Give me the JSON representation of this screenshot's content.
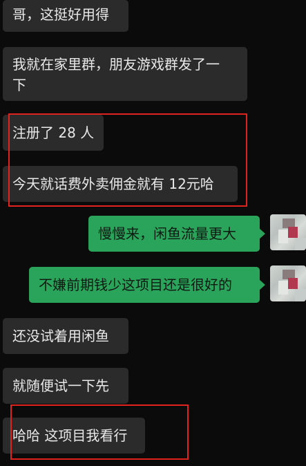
{
  "messages": [
    {
      "side": "left",
      "text": "哥，这挺好用得"
    },
    {
      "side": "left",
      "text_line1": "我就在家里群，朋友游戏群发了一",
      "text_line2": "下"
    },
    {
      "side": "left",
      "text": "注册了 28 人"
    },
    {
      "side": "left",
      "text": "今天就话费外卖佣金就有 12元哈"
    },
    {
      "side": "right",
      "text": "慢慢来，闲鱼流量更大"
    },
    {
      "side": "right",
      "text": "不嫌前期钱少这项目还是很好的"
    },
    {
      "side": "left",
      "text": "还没试着用闲鱼"
    },
    {
      "side": "left",
      "text": "就随便试一下先"
    },
    {
      "side": "left",
      "text": "哈哈 这项目我看行"
    }
  ],
  "colors": {
    "background": "#0b0b0b",
    "left_bubble": "#2b2b2b",
    "right_bubble": "#2aa45a",
    "highlight_box": "#e0231f"
  },
  "avatars": {
    "self": "blurred-avatar-icon"
  }
}
